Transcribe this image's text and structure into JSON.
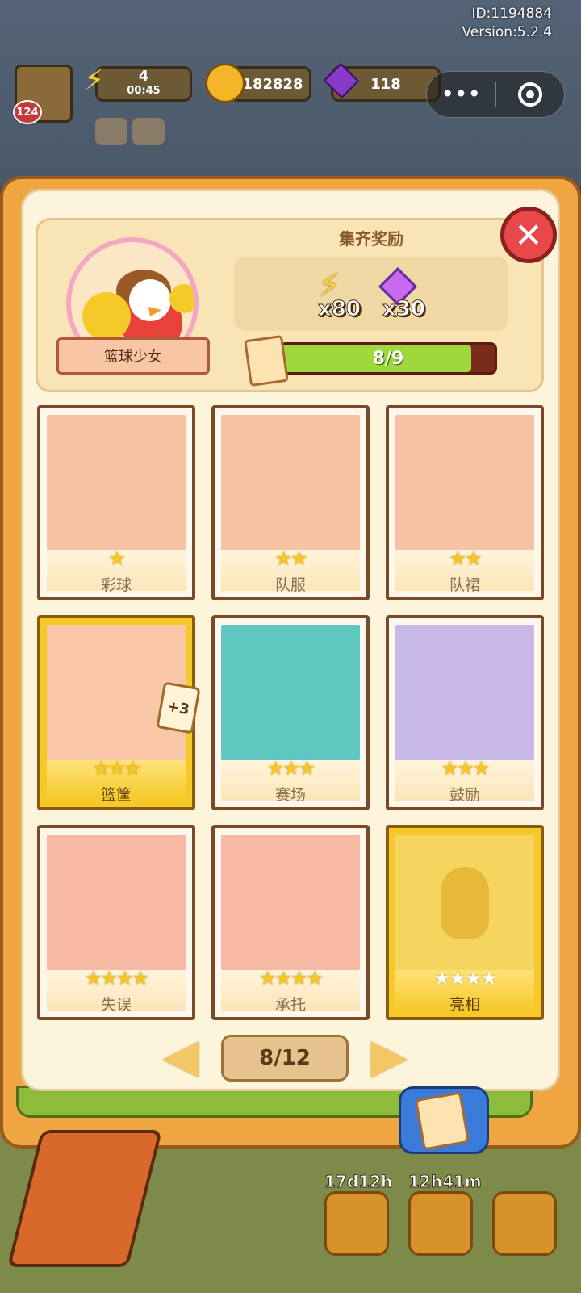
{
  "system": {
    "id_label": "ID:1194884",
    "version_label": "Version:5.2.4"
  },
  "hud": {
    "level": "124",
    "energy": "4",
    "energy_timer": "00:45",
    "coins": "182828",
    "gems": "118"
  },
  "collection": {
    "set_name": "篮球少女",
    "reward_title": "集齐奖励",
    "rewards": [
      {
        "icon": "lightning-icon",
        "amount": "x80"
      },
      {
        "icon": "gem-icon",
        "amount": "x30"
      }
    ],
    "progress_text": "8/9",
    "progress_value": 0.8889
  },
  "cards": [
    {
      "label": "彩球",
      "stars": "★",
      "owned": true
    },
    {
      "label": "队服",
      "stars": "★★",
      "owned": true
    },
    {
      "label": "队裙",
      "stars": "★★",
      "owned": true
    },
    {
      "label": "篮筐",
      "stars": "★★★",
      "owned": true,
      "gold": true,
      "duplicates": "+3"
    },
    {
      "label": "赛场",
      "stars": "★★★",
      "owned": true
    },
    {
      "label": "鼓励",
      "stars": "★★★",
      "owned": true
    },
    {
      "label": "失误",
      "stars": "★★★★",
      "owned": true
    },
    {
      "label": "承托",
      "stars": "★★★★",
      "owned": true
    },
    {
      "label": "亮相",
      "stars": "★★★★",
      "owned": false,
      "gold": true
    }
  ],
  "pagination": {
    "page_text": "8/12"
  },
  "bottom": {
    "timer1": "17d12h",
    "timer2": "12h41m"
  },
  "colors": {
    "accent": "#f0a640",
    "progress": "#9ed83a",
    "close": "#e8484a"
  }
}
